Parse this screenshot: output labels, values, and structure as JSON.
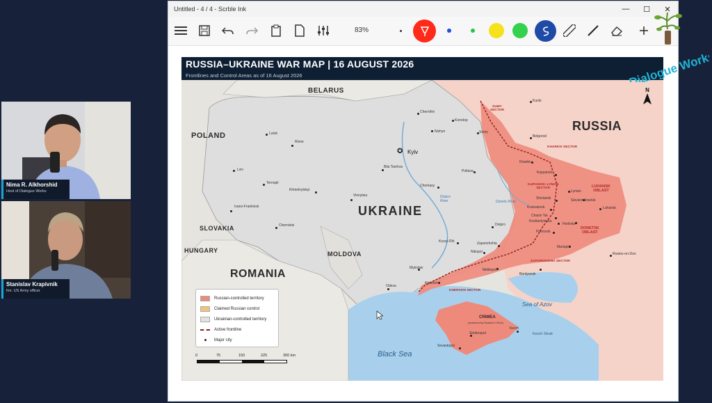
{
  "participants": [
    {
      "name": "Nima R. Alkhorshid",
      "role": "Host of Dialogue Works"
    },
    {
      "name": "Stanislav Krapivnik",
      "role": "fmr. US Army officer"
    }
  ],
  "window": {
    "title": "Untitled - 4 / 4 - Scrble Ink",
    "controls": {
      "minimize": "—",
      "maximize": "☐",
      "close": "✕"
    }
  },
  "toolbar": {
    "zoom": "83%",
    "icons": [
      "menu-icon",
      "save-icon",
      "undo-icon",
      "redo-icon",
      "clipboard-icon",
      "page-icon",
      "sliders-icon",
      "pen-icon",
      "highlighter-icon",
      "ruler-icon",
      "line-icon",
      "eraser-icon",
      "plus-icon"
    ],
    "colors": {
      "red": "#ff2a1a",
      "blue": "#1d4fd8",
      "green": "#26c443",
      "yellow": "#f5e11c",
      "bright_green": "#33d14c",
      "navy": "#1f4aa8"
    }
  },
  "map": {
    "title": "RUSSIA–UKRAINE WAR MAP  |  16 AUGUST 2026",
    "subtitle": "Frontlines and Control Areas as of 16 August 2026",
    "countries": {
      "belarus": "BELARUS",
      "russia": "RUSSIA",
      "poland": "POLAND",
      "ukraine": "UKRAINE",
      "slovakia": "SLOVAKIA",
      "hungary": "HUNGARY",
      "romania": "ROMANIA",
      "moldova": "MOLDOVA"
    },
    "seas": {
      "black_sea": "Black Sea",
      "azov": "Sea of Azov",
      "kerch": "Kerch Strait"
    },
    "cities": {
      "kyiv": "Kyiv",
      "lutsk": "Lutsk",
      "rivne": "Rivne",
      "lviv": "Lviv",
      "ternopil": "Ternopil",
      "khmelnytskyi": "Khmelnytskyi",
      "ivano": "Ivano-Frankivsk",
      "chernivtsi": "Chernivtsi",
      "vinnytsia": "Vinnytsia",
      "bila": "Bila Tserkva",
      "chernihiv": "Chernihiv",
      "konotop": "Konotop",
      "nizhyn": "Nizhyn",
      "sumy": "Sumy",
      "kursk": "Kursk",
      "belgorod": "Belgorod",
      "kharkiv": "Kharkiv",
      "poltava": "Poltava",
      "cherkasy": "Cherkasy",
      "kupyansk": "Kupyansk",
      "lyman": "Lyman",
      "sloviansk": "Sloviansk",
      "kramatorsk": "Kramatorsk",
      "chasiv": "Chasiv Yar",
      "kostiantynivka": "Kostiantynivka",
      "pokrovsk": "Pokrovsk",
      "dnipro": "Dnipro",
      "kryvyi": "Kryvyi Rih",
      "zaporizhzhia": "Zaporizhzhia",
      "nikopol": "Nikopol",
      "mykolaiv": "Mykolaiv",
      "kherson": "Kherson",
      "odesa": "Odesa",
      "melitopol": "Melitopol",
      "berdyansk": "Berdyansk",
      "mariupol": "Mariupol",
      "horlivka": "Horlivka",
      "severodonetsk": "Sievierodonetsk",
      "luhansk": "Luhansk",
      "rostov": "Rostov-on-Don",
      "sevastopol": "Sevastopol",
      "simferopol": "Simferopol",
      "kerch": "Kerch"
    },
    "sectors": {
      "sumy": "SUMY\nSECTOR",
      "kharkiv": "KHARKIV SECTOR",
      "kupiansk": "KUPIANSK–LYMAN\nSECTOR",
      "luhansk_oblast": "LUHANSK\nOBLAST",
      "donetsk_oblast": "DONETSK\nOBLAST",
      "zaporizhzhia": "ZAPORIZHZHIA SECTOR",
      "kherson": "KHERSON SECTOR",
      "crimea": "CRIMEA",
      "crimea_note": "(annexed by Russia in 2014)"
    },
    "rivers": {
      "dnipro": "Dnipro\nRiver",
      "donets": "Donets River"
    },
    "north": "N",
    "legend": [
      {
        "label": "Russian-controlled territory",
        "color": "#ee8a7b"
      },
      {
        "label": "Claimed Russian control",
        "color": "#f2c27a"
      },
      {
        "label": "Ukrainian-controlled territory",
        "color": "#e2e2e2"
      },
      {
        "label": "Active frontline",
        "color": "#8a1f1f"
      },
      {
        "label": "Major city",
        "color": "#222222"
      }
    ],
    "scale": [
      "0",
      "75",
      "150",
      "225",
      "300 km"
    ]
  },
  "logo": {
    "text": "Dialogue Works",
    "color": "#1fb3d4"
  }
}
